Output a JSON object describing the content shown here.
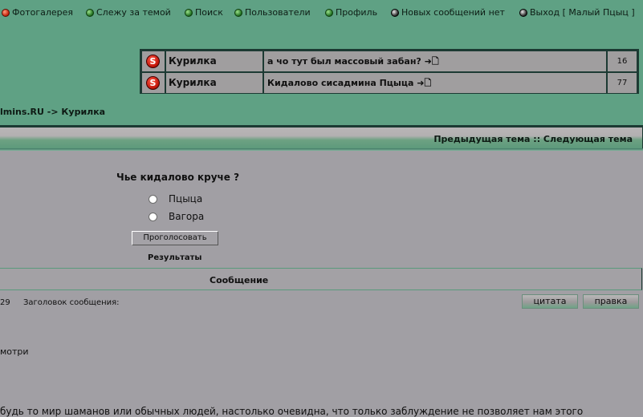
{
  "nav": {
    "items": [
      {
        "label": "Фотогалерея"
      },
      {
        "label": "Слежу за темой"
      },
      {
        "label": "Поиск"
      },
      {
        "label": "Пользователи"
      },
      {
        "label": "Профиль"
      },
      {
        "label": "Новых сообщений нет"
      },
      {
        "label": "Выход [ Малый Пцыц ]"
      }
    ]
  },
  "recent_topics": [
    {
      "icon": "S",
      "forum": "Курилка",
      "topic": "а чо тут был массовый забан? ➜🗋",
      "count": "16"
    },
    {
      "icon": "S",
      "forum": "Курилка",
      "topic": "Кидалово сисадмина Пцыца ➜🗋",
      "count": "77"
    }
  ],
  "breadcrumb": "lmins.RU -> Курилка",
  "topic_nav": "Предыдущая тема :: Следующая тема",
  "poll": {
    "question": "Чье кидалово круче ?",
    "options": [
      "Пцыца",
      "Вагора"
    ],
    "vote_label": "Проголосовать",
    "results_label": "Результаты"
  },
  "message_header": "Сообщение",
  "post": {
    "number": "29",
    "subject_label": "Заголовок сообщения:",
    "quote_label": "цитата",
    "edit_label": "правка",
    "line1": "мотри",
    "line2": "будь то мир шаманов или обычных людей, настолько очевидна, что только заблуждение не позволяет нам этого"
  }
}
